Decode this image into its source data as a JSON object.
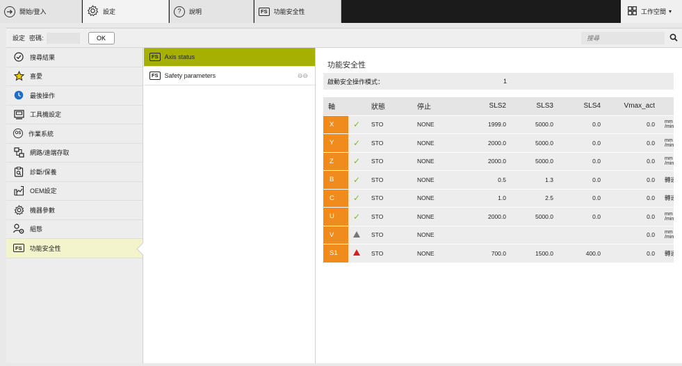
{
  "topbar": {
    "tabs": [
      {
        "icon": "login-arrow-icon",
        "label": "開始/登入"
      },
      {
        "icon": "gear-icon",
        "label": "設定"
      },
      {
        "icon": "help-icon",
        "label": "說明"
      },
      {
        "icon": "fs-icon",
        "label": "功能安全性",
        "icon_text": "FS"
      }
    ],
    "workspace": {
      "icon": "grid-icon",
      "label": "工作空間",
      "caret": "▾"
    }
  },
  "toolbar": {
    "settings_label": "設定",
    "password_label": "密碼:",
    "password_value": "",
    "ok_label": "OK",
    "search_placeholder": "搜尋"
  },
  "nav": {
    "items": [
      {
        "icon": "check-circle-icon",
        "label": "搜尋結果"
      },
      {
        "icon": "star-icon",
        "label": "喜愛"
      },
      {
        "icon": "clock-icon",
        "label": "最後操作"
      },
      {
        "icon": "machine-config-icon",
        "label": "工具機設定"
      },
      {
        "icon": "os-icon",
        "label": "作業系統",
        "icon_text": "OS"
      },
      {
        "icon": "network-icon",
        "label": "網路/遠端存取"
      },
      {
        "icon": "diagnosis-icon",
        "label": "診斷/保養"
      },
      {
        "icon": "oem-icon",
        "label": "OEM設定"
      },
      {
        "icon": "gear-icon",
        "label": "機器參數"
      },
      {
        "icon": "user-settings-icon",
        "label": "組態"
      },
      {
        "icon": "fs-icon",
        "label": "功能安全性",
        "icon_text": "FS",
        "active": true
      }
    ]
  },
  "middle": {
    "items": [
      {
        "icon": "fs-icon",
        "icon_text": "FS",
        "label": "Axis status",
        "active": true
      },
      {
        "icon": "fs-icon",
        "icon_text": "FS",
        "label": "Safety parameters",
        "link_icon": "link-icon",
        "link_glyph": "⊖⊖"
      }
    ]
  },
  "content": {
    "title": "功能安全性",
    "mode_label": "啟動安全操作模式：",
    "mode_value": "1",
    "columns": [
      "軸",
      "",
      "狀態",
      "停止",
      "SLS2",
      "SLS3",
      "SLS4",
      "Vmax_act",
      ""
    ],
    "rows": [
      {
        "axis": "X",
        "status_icon": "check-icon",
        "status": "STO",
        "stop": "NONE",
        "sls2": "1999.0",
        "sls3": "5000.0",
        "sls4": "0.0",
        "vmax": "0.0",
        "unit": "mm/min"
      },
      {
        "axis": "Y",
        "status_icon": "check-icon",
        "status": "STO",
        "stop": "NONE",
        "sls2": "2000.0",
        "sls3": "5000.0",
        "sls4": "0.0",
        "vmax": "0.0",
        "unit": "mm/min"
      },
      {
        "axis": "Z",
        "status_icon": "check-icon",
        "status": "STO",
        "stop": "NONE",
        "sls2": "2000.0",
        "sls3": "5000.0",
        "sls4": "0.0",
        "vmax": "0.0",
        "unit": "mm/min"
      },
      {
        "axis": "B",
        "status_icon": "check-icon",
        "status": "STO",
        "stop": "NONE",
        "sls2": "0.5",
        "sls3": "1.3",
        "sls4": "0.0",
        "vmax": "0.0",
        "unit": "轉速"
      },
      {
        "axis": "C",
        "status_icon": "check-icon",
        "status": "STO",
        "stop": "NONE",
        "sls2": "1.0",
        "sls3": "2.5",
        "sls4": "0.0",
        "vmax": "0.0",
        "unit": "轉速"
      },
      {
        "axis": "U",
        "status_icon": "check-icon",
        "status": "STO",
        "stop": "NONE",
        "sls2": "2000.0",
        "sls3": "5000.0",
        "sls4": "0.0",
        "vmax": "0.0",
        "unit": "mm/min"
      },
      {
        "axis": "V",
        "status_icon": "warning-grey-icon",
        "status": "STO",
        "stop": "NONE",
        "sls2": "",
        "sls3": "",
        "sls4": "",
        "vmax": "0.0",
        "unit": "mm/min"
      },
      {
        "axis": "S1",
        "status_icon": "warning-red-icon",
        "status": "STO",
        "stop": "NONE",
        "sls2": "700.0",
        "sls3": "1500.0",
        "sls4": "400.0",
        "vmax": "0.0",
        "unit": "轉速"
      }
    ]
  },
  "colors": {
    "axis_orange": "#f08c1e",
    "active_item": "#a6b000",
    "active_nav": "#f4f4cc",
    "check_green": "#7db928",
    "warning_red": "#d42020",
    "warning_grey": "#777777"
  }
}
